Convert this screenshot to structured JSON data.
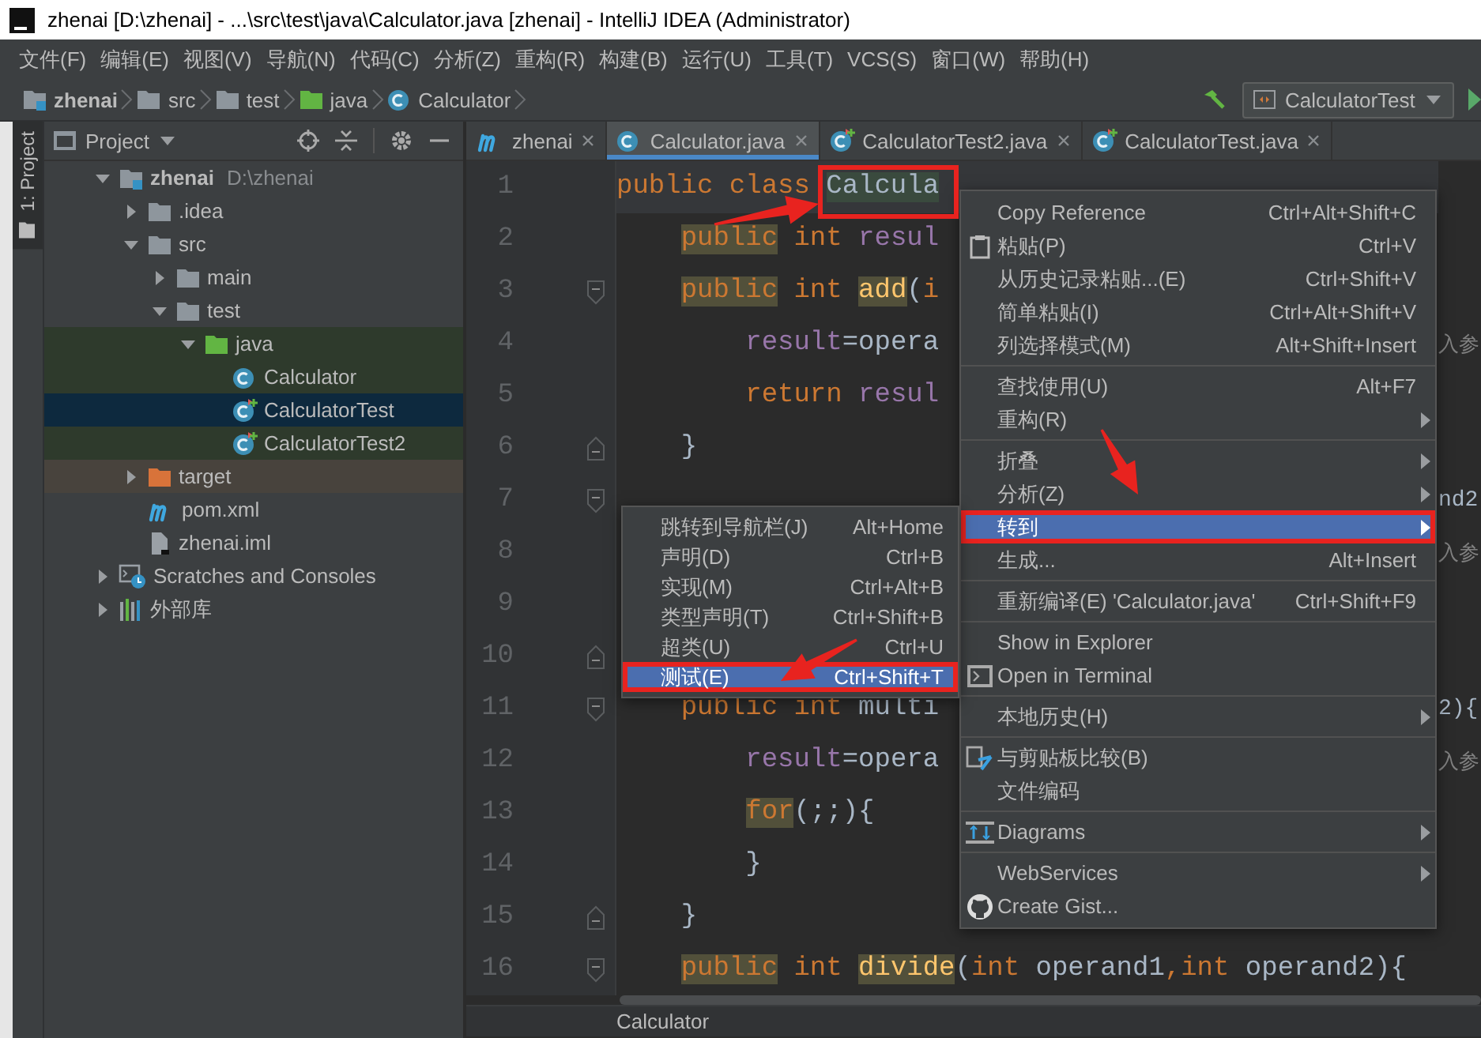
{
  "window": {
    "title": "zhenai [D:\\zhenai] - ...\\src\\test\\java\\Calculator.java [zhenai] - IntelliJ IDEA (Administrator)"
  },
  "menu_bar": [
    "文件(F)",
    "编辑(E)",
    "视图(V)",
    "导航(N)",
    "代码(C)",
    "分析(Z)",
    "重构(R)",
    "构建(B)",
    "运行(U)",
    "工具(T)",
    "VCS(S)",
    "窗口(W)",
    "帮助(H)"
  ],
  "nav_bar": {
    "crumbs": [
      {
        "label": "zhenai",
        "kind": "module"
      },
      {
        "label": "src",
        "kind": "folder"
      },
      {
        "label": "test",
        "kind": "folder"
      },
      {
        "label": "java",
        "kind": "test-source-folder"
      },
      {
        "label": "Calculator",
        "kind": "class"
      }
    ],
    "run_config": "CalculatorTest"
  },
  "tool_window": {
    "label": "1: Project",
    "selected": true
  },
  "project_panel": {
    "view": "Project",
    "tree": [
      {
        "label": "zhenai",
        "path": "D:\\zhenai",
        "kind": "module",
        "expanded": true,
        "selected": false,
        "test": false,
        "excluded": false,
        "children": [
          {
            "label": ".idea",
            "kind": "folder",
            "expanded": false,
            "selected": false,
            "test": false,
            "excluded": false
          },
          {
            "label": "src",
            "kind": "folder",
            "expanded": true,
            "selected": false,
            "test": false,
            "excluded": false,
            "children": [
              {
                "label": "main",
                "kind": "folder",
                "expanded": false,
                "selected": false,
                "test": false,
                "excluded": false
              },
              {
                "label": "test",
                "kind": "folder",
                "expanded": true,
                "selected": false,
                "test": false,
                "excluded": false,
                "children": [
                  {
                    "label": "java",
                    "kind": "test-source-folder",
                    "expanded": true,
                    "selected": false,
                    "test": true,
                    "excluded": false,
                    "children": [
                      {
                        "label": "Calculator",
                        "kind": "class",
                        "selected": false,
                        "test": true,
                        "excluded": false
                      },
                      {
                        "label": "CalculatorTest",
                        "kind": "test-class",
                        "selected": true,
                        "test": true,
                        "excluded": false
                      },
                      {
                        "label": "CalculatorTest2",
                        "kind": "test-class",
                        "selected": false,
                        "test": true,
                        "excluded": false
                      }
                    ]
                  }
                ]
              }
            ]
          },
          {
            "label": "target",
            "kind": "excluded-folder",
            "expanded": false,
            "selected": false,
            "test": false,
            "excluded": true
          },
          {
            "label": "pom.xml",
            "kind": "maven",
            "selected": false,
            "test": false,
            "excluded": false
          },
          {
            "label": "zhenai.iml",
            "kind": "file",
            "selected": false,
            "test": false,
            "excluded": false
          }
        ]
      },
      {
        "label": "Scratches and Consoles",
        "kind": "scratches",
        "expanded": false,
        "selected": false,
        "test": false,
        "excluded": false
      },
      {
        "label": "外部库",
        "kind": "library",
        "expanded": false,
        "selected": false,
        "test": false,
        "excluded": false
      }
    ]
  },
  "editor": {
    "tabs": [
      {
        "label": "zhenai",
        "kind": "maven",
        "selected": false
      },
      {
        "label": "Calculator.java",
        "kind": "class",
        "selected": true
      },
      {
        "label": "CalculatorTest2.java",
        "kind": "test-class",
        "selected": false
      },
      {
        "label": "CalculatorTest.java",
        "kind": "test-class",
        "selected": false
      }
    ],
    "lines": [
      {
        "number": "1",
        "current": true,
        "fold_open": false,
        "fold_close": false,
        "tokens": [
          {
            "text": "public class ",
            "kind": "keyword",
            "highlighted": false
          },
          {
            "text": "Calcula",
            "kind": "class",
            "highlighted": true
          }
        ]
      },
      {
        "number": "2",
        "current": false,
        "fold_open": false,
        "fold_close": false,
        "tokens": [
          {
            "text": "    public",
            "kind": "keyword",
            "highlighted": true
          },
          {
            "text": " int ",
            "kind": "keyword",
            "highlighted": false
          },
          {
            "text": "resul",
            "kind": "field",
            "highlighted": false
          }
        ]
      },
      {
        "number": "3",
        "current": false,
        "fold_open": true,
        "fold_close": false,
        "tokens": [
          {
            "text": "    public",
            "kind": "keyword",
            "highlighted": true
          },
          {
            "text": " int ",
            "kind": "keyword",
            "highlighted": false
          },
          {
            "text": "add",
            "kind": "method",
            "highlighted": true
          },
          {
            "text": "(",
            "kind": "plain",
            "highlighted": false
          },
          {
            "text": "i",
            "kind": "keyword",
            "highlighted": false
          }
        ]
      },
      {
        "number": "4",
        "current": false,
        "fold_open": false,
        "fold_close": false,
        "tokens": [
          {
            "text": "        result",
            "kind": "field",
            "highlighted": false
          },
          {
            "text": "=opera",
            "kind": "plain",
            "highlighted": false
          }
        ],
        "tail": {
          "text": "入参",
          "kind": "comment"
        }
      },
      {
        "number": "5",
        "current": false,
        "fold_open": false,
        "fold_close": false,
        "tokens": [
          {
            "text": "        return ",
            "kind": "keyword",
            "highlighted": false
          },
          {
            "text": "resul",
            "kind": "field",
            "highlighted": false
          }
        ]
      },
      {
        "number": "6",
        "current": false,
        "fold_open": false,
        "fold_close": true,
        "tokens": [
          {
            "text": "    }",
            "kind": "plain",
            "highlighted": false
          }
        ]
      },
      {
        "number": "7",
        "current": false,
        "fold_open": true,
        "fold_close": false,
        "tail": {
          "text": "nd2",
          "kind": "plain"
        }
      },
      {
        "number": "8",
        "current": false,
        "fold_open": false,
        "fold_close": false,
        "tail": {
          "text": "入参",
          "kind": "comment"
        }
      },
      {
        "number": "9",
        "current": false,
        "fold_open": false,
        "fold_close": false
      },
      {
        "number": "10",
        "current": false,
        "fold_open": false,
        "fold_close": true
      },
      {
        "number": "11",
        "current": false,
        "fold_open": true,
        "fold_close": false,
        "tokens": [
          {
            "text": "    public",
            "kind": "keyword",
            "highlighted": false
          },
          {
            "text": " int ",
            "kind": "keyword",
            "highlighted": false
          },
          {
            "text": "multi",
            "kind": "plain",
            "highlighted": false
          }
        ],
        "tail": {
          "text": "2){",
          "kind": "plain"
        }
      },
      {
        "number": "12",
        "current": false,
        "fold_open": false,
        "fold_close": false,
        "tokens": [
          {
            "text": "        result",
            "kind": "field",
            "highlighted": false
          },
          {
            "text": "=opera",
            "kind": "plain",
            "highlighted": false
          }
        ],
        "tail": {
          "text": "入参",
          "kind": "comment"
        }
      },
      {
        "number": "13",
        "current": false,
        "fold_open": false,
        "fold_close": false,
        "tokens": [
          {
            "text": "        for",
            "kind": "keyword",
            "highlighted": true
          },
          {
            "text": "(;;){",
            "kind": "plain",
            "highlighted": false
          }
        ]
      },
      {
        "number": "14",
        "current": false,
        "fold_open": false,
        "fold_close": false,
        "tokens": [
          {
            "text": "        }",
            "kind": "plain",
            "highlighted": false
          }
        ]
      },
      {
        "number": "15",
        "current": false,
        "fold_open": false,
        "fold_close": true,
        "tokens": [
          {
            "text": "    }",
            "kind": "plain",
            "highlighted": false
          }
        ]
      },
      {
        "number": "16",
        "current": false,
        "fold_open": true,
        "fold_close": false,
        "tokens": [
          {
            "text": "    public",
            "kind": "keyword",
            "highlighted": true
          },
          {
            "text": " int ",
            "kind": "keyword",
            "highlighted": false
          },
          {
            "text": "divide",
            "kind": "method",
            "highlighted": true
          },
          {
            "text": "(",
            "kind": "plain",
            "highlighted": false
          },
          {
            "text": "int",
            "kind": "keyword",
            "highlighted": false
          },
          {
            "text": " operand1",
            "kind": "plain",
            "highlighted": false
          },
          {
            "text": ",",
            "kind": "keyword",
            "highlighted": false
          },
          {
            "text": "int",
            "kind": "keyword",
            "highlighted": false
          },
          {
            "text": " operand2){",
            "kind": "plain",
            "highlighted": false
          }
        ]
      }
    ],
    "breadcrumb": "Calculator"
  },
  "context_menu": {
    "items": [
      {
        "kind": "item",
        "label": "Copy Reference",
        "shortcut": "Ctrl+Alt+Shift+C",
        "has_submenu": false,
        "selected": false,
        "outlined": false
      },
      {
        "kind": "item",
        "label": "粘贴(P)",
        "shortcut": "Ctrl+V",
        "has_submenu": false,
        "selected": false,
        "outlined": false
      },
      {
        "kind": "item",
        "label": "从历史记录粘贴...(E)",
        "shortcut": "Ctrl+Shift+V",
        "has_submenu": false,
        "selected": false,
        "outlined": false
      },
      {
        "kind": "item",
        "label": "简单粘贴(I)",
        "shortcut": "Ctrl+Alt+Shift+V",
        "has_submenu": false,
        "selected": false,
        "outlined": false
      },
      {
        "kind": "item",
        "label": "列选择模式(M)",
        "shortcut": "Alt+Shift+Insert",
        "has_submenu": false,
        "selected": false,
        "outlined": false
      },
      {
        "kind": "separator"
      },
      {
        "kind": "item",
        "label": "查找使用(U)",
        "shortcut": "Alt+F7",
        "has_submenu": false,
        "selected": false,
        "outlined": false
      },
      {
        "kind": "item",
        "label": "重构(R)",
        "has_submenu": true,
        "selected": false,
        "outlined": false
      },
      {
        "kind": "separator"
      },
      {
        "kind": "item",
        "label": "折叠",
        "has_submenu": true,
        "selected": false,
        "outlined": false
      },
      {
        "kind": "item",
        "label": "分析(Z)",
        "has_submenu": true,
        "selected": false,
        "outlined": false
      },
      {
        "kind": "item",
        "label": "转到",
        "has_submenu": true,
        "selected": true,
        "outlined": true
      },
      {
        "kind": "item",
        "label": "生成...",
        "shortcut": "Alt+Insert",
        "has_submenu": false,
        "selected": false,
        "outlined": false
      },
      {
        "kind": "separator"
      },
      {
        "kind": "item",
        "label": "重新编译(E) 'Calculator.java'",
        "shortcut": "Ctrl+Shift+F9",
        "has_submenu": false,
        "selected": false,
        "outlined": false
      },
      {
        "kind": "separator"
      },
      {
        "kind": "item",
        "label": "Show in Explorer",
        "has_submenu": false,
        "selected": false,
        "outlined": false
      },
      {
        "kind": "item",
        "label": "Open in Terminal",
        "has_submenu": false,
        "selected": false,
        "outlined": false
      },
      {
        "kind": "separator"
      },
      {
        "kind": "item",
        "label": "本地历史(H)",
        "has_submenu": true,
        "selected": false,
        "outlined": false
      },
      {
        "kind": "separator"
      },
      {
        "kind": "item",
        "label": "与剪贴板比较(B)",
        "has_submenu": false,
        "selected": false,
        "outlined": false
      },
      {
        "kind": "item",
        "label": "文件编码",
        "has_submenu": false,
        "selected": false,
        "outlined": false
      },
      {
        "kind": "separator"
      },
      {
        "kind": "item",
        "label": "Diagrams",
        "has_submenu": true,
        "selected": false,
        "outlined": false
      },
      {
        "kind": "separator"
      },
      {
        "kind": "item",
        "label": "WebServices",
        "has_submenu": true,
        "selected": false,
        "outlined": false
      },
      {
        "kind": "item",
        "label": "Create Gist...",
        "has_submenu": false,
        "selected": false,
        "outlined": false
      }
    ]
  },
  "submenu": {
    "items": [
      {
        "kind": "item",
        "label": "跳转到导航栏(J)",
        "shortcut": "Alt+Home",
        "has_submenu": false,
        "selected": false,
        "outlined": false
      },
      {
        "kind": "item",
        "label": "声明(D)",
        "shortcut": "Ctrl+B",
        "has_submenu": false,
        "selected": false,
        "outlined": false
      },
      {
        "kind": "item",
        "label": "实现(M)",
        "shortcut": "Ctrl+Alt+B",
        "has_submenu": false,
        "selected": false,
        "outlined": false
      },
      {
        "kind": "item",
        "label": "类型声明(T)",
        "shortcut": "Ctrl+Shift+B",
        "has_submenu": false,
        "selected": false,
        "outlined": false
      },
      {
        "kind": "item",
        "label": "超类(U)",
        "shortcut": "Ctrl+U",
        "has_submenu": false,
        "selected": false,
        "outlined": false
      },
      {
        "kind": "item",
        "label": "测试(E)",
        "shortcut": "Ctrl+Shift+T",
        "has_submenu": false,
        "selected": true,
        "outlined": true
      }
    ]
  }
}
